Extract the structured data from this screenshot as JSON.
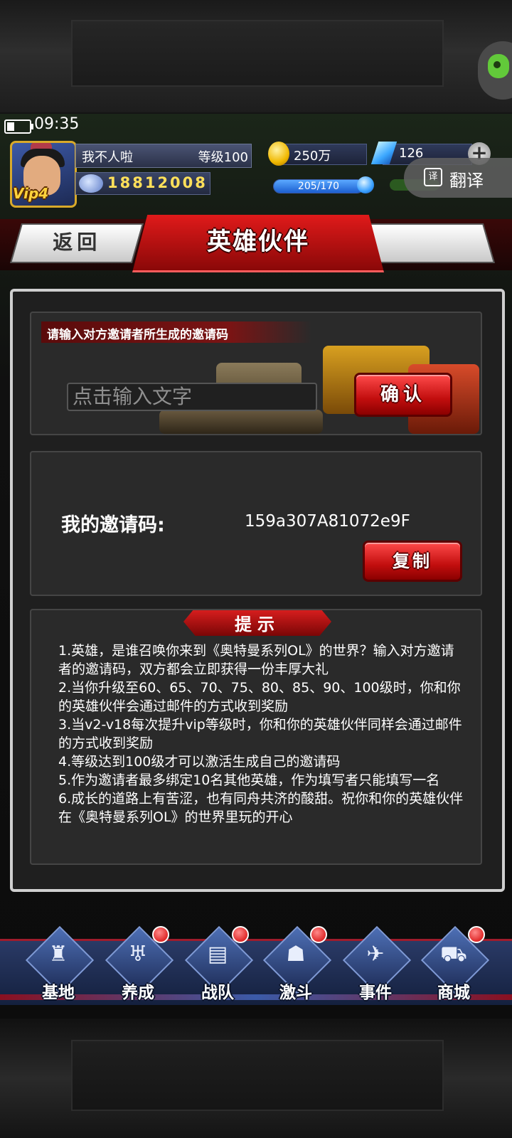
{
  "status": {
    "time": "09:35"
  },
  "player": {
    "name": "我不人啦",
    "level": "等级100",
    "id": "18812008",
    "vip": "Vip4"
  },
  "resources": {
    "gold": "250万",
    "gems": "126",
    "energy": "205/170",
    "energy_fill": 1.0
  },
  "overlay": {
    "translate": "翻译",
    "translate_icon": "译"
  },
  "header": {
    "back": "返回",
    "title": "英雄伙伴"
  },
  "invite": {
    "prompt": "请输入对方邀请者所生成的邀请码",
    "placeholder": "点击输入文字",
    "confirm": "确认"
  },
  "my_code": {
    "label": "我的邀请码:",
    "value": "159a307A81072e9F",
    "copy": "复制"
  },
  "tips": {
    "title": "提示",
    "body": "1.英雄，是谁召唤你来到《奥特曼系列OL》的世界？输入对方邀请者的邀请码，双方都会立即获得一份丰厚大礼\n2.当你升级至60、65、70、75、80、85、90、100级时，你和你的英雄伙伴会通过邮件的方式收到奖励\n3.当v2-v18每次提升vip等级时，你和你的英雄伙伴同样会通过邮件的方式收到奖励\n4.等级达到100级才可以激活生成自己的邀请码\n5.作为邀请者最多绑定10名其他英雄，作为填写者只能填写一名\n6.成长的道路上有苦涩，也有同舟共济的酸甜。祝你和你的英雄伙伴在《奥特曼系列OL》的世界里玩的开心"
  },
  "nav": [
    {
      "label": "基地",
      "icon": "base-icon",
      "glyph": "♜",
      "badge": false
    },
    {
      "label": "养成",
      "icon": "training-icon",
      "glyph": "♅",
      "badge": true
    },
    {
      "label": "战队",
      "icon": "team-icon",
      "glyph": "▤",
      "badge": true
    },
    {
      "label": "激斗",
      "icon": "battle-icon",
      "glyph": "☗",
      "badge": true
    },
    {
      "label": "事件",
      "icon": "event-icon",
      "glyph": "✈",
      "badge": false
    },
    {
      "label": "商城",
      "icon": "shop-cart-icon",
      "glyph": "⛟",
      "badge": true
    }
  ],
  "colors": {
    "accent_red": "#c20e0e",
    "nav_blue": "#2a3a66",
    "gold_text": "#ffe05a"
  }
}
